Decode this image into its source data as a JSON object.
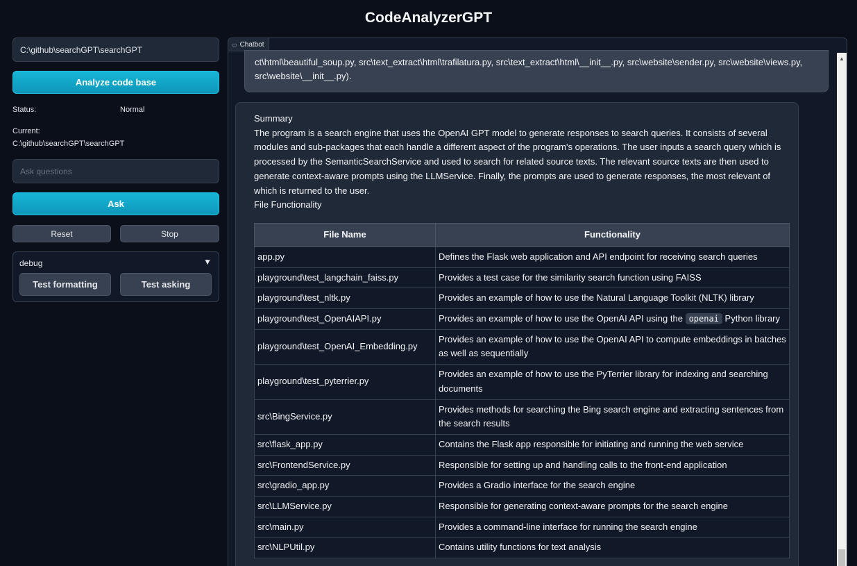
{
  "app_title": "CodeAnalyzerGPT",
  "left_panel": {
    "path_input_value": "C:\\github\\searchGPT\\searchGPT",
    "analyze_button": "Analyze code base",
    "status_label": "Status:",
    "status_value": "Normal",
    "current_label": "Current:",
    "current_value": "C:\\github\\searchGPT\\searchGPT",
    "ask_placeholder": "Ask questions",
    "ask_button": "Ask",
    "reset_button": "Reset",
    "stop_button": "Stop",
    "debug": {
      "title": "debug",
      "chevron": "▼",
      "test_formatting_button": "Test formatting",
      "test_asking_button": "Test asking"
    }
  },
  "chatbot": {
    "label": "Chatbot",
    "user_message": "ct\\html\\beautiful_soup.py, src\\text_extract\\html\\trafilatura.py, src\\text_extract\\html\\__init__.py, src\\website\\sender.py, src\\website\\views.py, src\\website\\__init__.py).",
    "bot": {
      "summary_heading": "Summary",
      "summary_text": "The program is a search engine that uses the OpenAI GPT model to generate responses to search queries. It consists of several modules and sub-packages that each handle a different aspect of the program's operations. The user inputs a search query which is processed by the SemanticSearchService and used to search for related source texts. The relevant source texts are then used to generate context-aware prompts using the LLMService. Finally, the prompts are used to generate responses, the most relevant of which is returned to the user.",
      "file_functionality_heading": "File Functionality",
      "table_headers": [
        "File Name",
        "Functionality"
      ],
      "rows": [
        {
          "file": "app.py",
          "desc": "Defines the Flask web application and API endpoint for receiving search queries"
        },
        {
          "file": "playground\\test_langchain_faiss.py",
          "desc": "Provides a test case for the similarity search function using FAISS"
        },
        {
          "file": "playground\\test_nltk.py",
          "desc": "Provides an example of how to use the Natural Language Toolkit (NLTK) library"
        },
        {
          "file": "playground\\test_OpenAIAPI.py",
          "desc_pre": "Provides an example of how to use the OpenAI API using the ",
          "code": "openai",
          "desc_post": " Python library"
        },
        {
          "file": "playground\\test_OpenAI_Embedding.py",
          "desc": "Provides an example of how to use the OpenAI API to compute embeddings in batches as well as sequentially"
        },
        {
          "file": "playground\\test_pyterrier.py",
          "desc": "Provides an example of how to use the PyTerrier library for indexing and searching documents"
        },
        {
          "file": "src\\BingService.py",
          "desc": "Provides methods for searching the Bing search engine and extracting sentences from the search results"
        },
        {
          "file": "src\\flask_app.py",
          "desc": "Contains the Flask app responsible for initiating and running the web service"
        },
        {
          "file": "src\\FrontendService.py",
          "desc": "Responsible for setting up and handling calls to the front-end application"
        },
        {
          "file": "src\\gradio_app.py",
          "desc": "Provides a Gradio interface for the search engine"
        },
        {
          "file": "src\\LLMService.py",
          "desc": "Responsible for generating context-aware prompts for the search engine"
        },
        {
          "file": "src\\main.py",
          "desc": "Provides a command-line interface for running the search engine"
        },
        {
          "file": "src\\NLPUtil.py",
          "desc": "Contains utility functions for text analysis"
        }
      ]
    }
  }
}
